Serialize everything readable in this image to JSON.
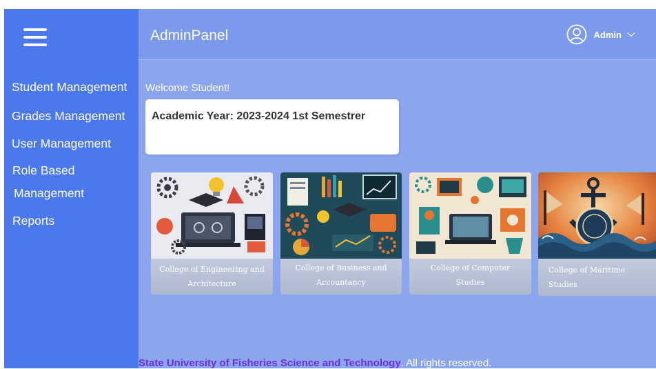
{
  "header": {
    "title": "AdminPanel",
    "user_name": "Admin"
  },
  "sidebar": {
    "items": [
      {
        "label": "Student Management"
      },
      {
        "label": "Grades Management"
      },
      {
        "label": "User Management"
      },
      {
        "label": "Role Based",
        "label2": "Management"
      },
      {
        "label": "Reports"
      }
    ]
  },
  "main": {
    "welcome": "Welcome Student!",
    "academic_year": "Academic Year: 2023-2024 1st Semestrer"
  },
  "colleges": [
    {
      "line1": "College of Engineering and",
      "line2": "Architecture"
    },
    {
      "line1": "College of Business and",
      "line2": "Accountancy"
    },
    {
      "line1": "College of Computer",
      "line2": "Studies"
    },
    {
      "line1": "College of Maritime Studies"
    }
  ],
  "footer": {
    "org": "State University of Fisheries Science and Technology",
    "rights": ". All rights reserved."
  },
  "colors": {
    "sidebar": "#4b78eb",
    "header": "#7b9aec",
    "main_bg": "#8ba6ef",
    "footer_org": "#6d2fd6"
  },
  "icons": {
    "menu": "hamburger-icon",
    "user": "user-avatar-icon",
    "dropdown": "chevron-down-icon"
  }
}
